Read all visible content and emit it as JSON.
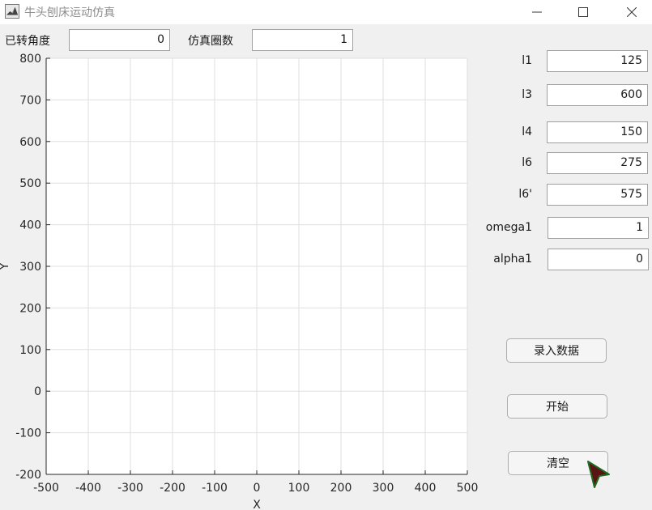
{
  "window": {
    "title": "牛头刨床运动仿真"
  },
  "top": {
    "angle_label": "已转角度",
    "angle_value": "0",
    "cycles_label": "仿真圈数",
    "cycles_value": "1"
  },
  "params": [
    {
      "label": "l1",
      "value": "125"
    },
    {
      "label": "l3",
      "value": "600"
    },
    {
      "label": "l4",
      "value": "150"
    },
    {
      "label": "l6",
      "value": "275"
    },
    {
      "label": "l6'",
      "value": "575"
    },
    {
      "label": "omega1",
      "value": "1"
    },
    {
      "label": "alpha1",
      "value": "0"
    }
  ],
  "buttons": {
    "enter_data": "录入数据",
    "start": "开始",
    "clear": "清空"
  },
  "chart_data": {
    "type": "scatter",
    "title": "",
    "xlabel": "X",
    "ylabel": "Y",
    "xlim": [
      -500,
      500
    ],
    "ylim": [
      -200,
      800
    ],
    "xticks": [
      -500,
      -400,
      -300,
      -200,
      -100,
      0,
      100,
      200,
      300,
      400,
      500
    ],
    "yticks": [
      -200,
      -100,
      0,
      100,
      200,
      300,
      400,
      500,
      600,
      700,
      800
    ],
    "grid": true,
    "series": []
  },
  "colors": {
    "window_bg": "#f0f0f0",
    "grid": "#dfdfdf",
    "axis": "#262626",
    "cursor_fill": "#5a1414",
    "cursor_edge": "#1f6b1f"
  },
  "icons": {
    "app": "matlab-icon",
    "minimize": "minimize-icon",
    "maximize": "maximize-icon",
    "close": "close-icon"
  }
}
